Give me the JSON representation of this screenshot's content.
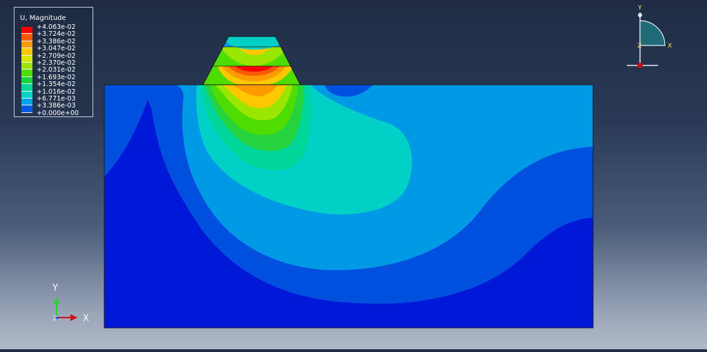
{
  "legend": {
    "title": "U, Magnitude",
    "entries": [
      {
        "label": "+4.063e-02",
        "color": "#ff0000"
      },
      {
        "label": "+3.724e-02",
        "color": "#ff5a00"
      },
      {
        "label": "+3.386e-02",
        "color": "#ff9b00"
      },
      {
        "label": "+3.047e-02",
        "color": "#ffc800"
      },
      {
        "label": "+2.709e-02",
        "color": "#d8e600"
      },
      {
        "label": "+2.370e-02",
        "color": "#9ae600"
      },
      {
        "label": "+2.031e-02",
        "color": "#4fdc00"
      },
      {
        "label": "+1.693e-02",
        "color": "#17d43a"
      },
      {
        "label": "+1.354e-02",
        "color": "#00d69a"
      },
      {
        "label": "+1.016e-02",
        "color": "#00d2c8"
      },
      {
        "label": "+6.771e-03",
        "color": "#00a3e8"
      },
      {
        "label": "+3.386e-03",
        "color": "#005be0"
      },
      {
        "label": "+0.000e+00",
        "color": "#0019d8"
      }
    ]
  },
  "triad": {
    "y": "Y",
    "x": "X",
    "z": "Z"
  },
  "view_cube": {
    "y": "Y",
    "x": "X",
    "z": "Z"
  },
  "colors": {
    "deep_blue": "#0019d8",
    "blue": "#0050df",
    "mid_blue": "#0099e6",
    "cyan": "#00d0c5",
    "green_cyan": "#00d69a",
    "green": "#24d33d",
    "bright_green": "#4fdc00",
    "yellow_green": "#9ae600",
    "yellow": "#ffc800",
    "orange": "#ff9b00",
    "red_orange": "#ff5a00",
    "red": "#ff0000"
  }
}
